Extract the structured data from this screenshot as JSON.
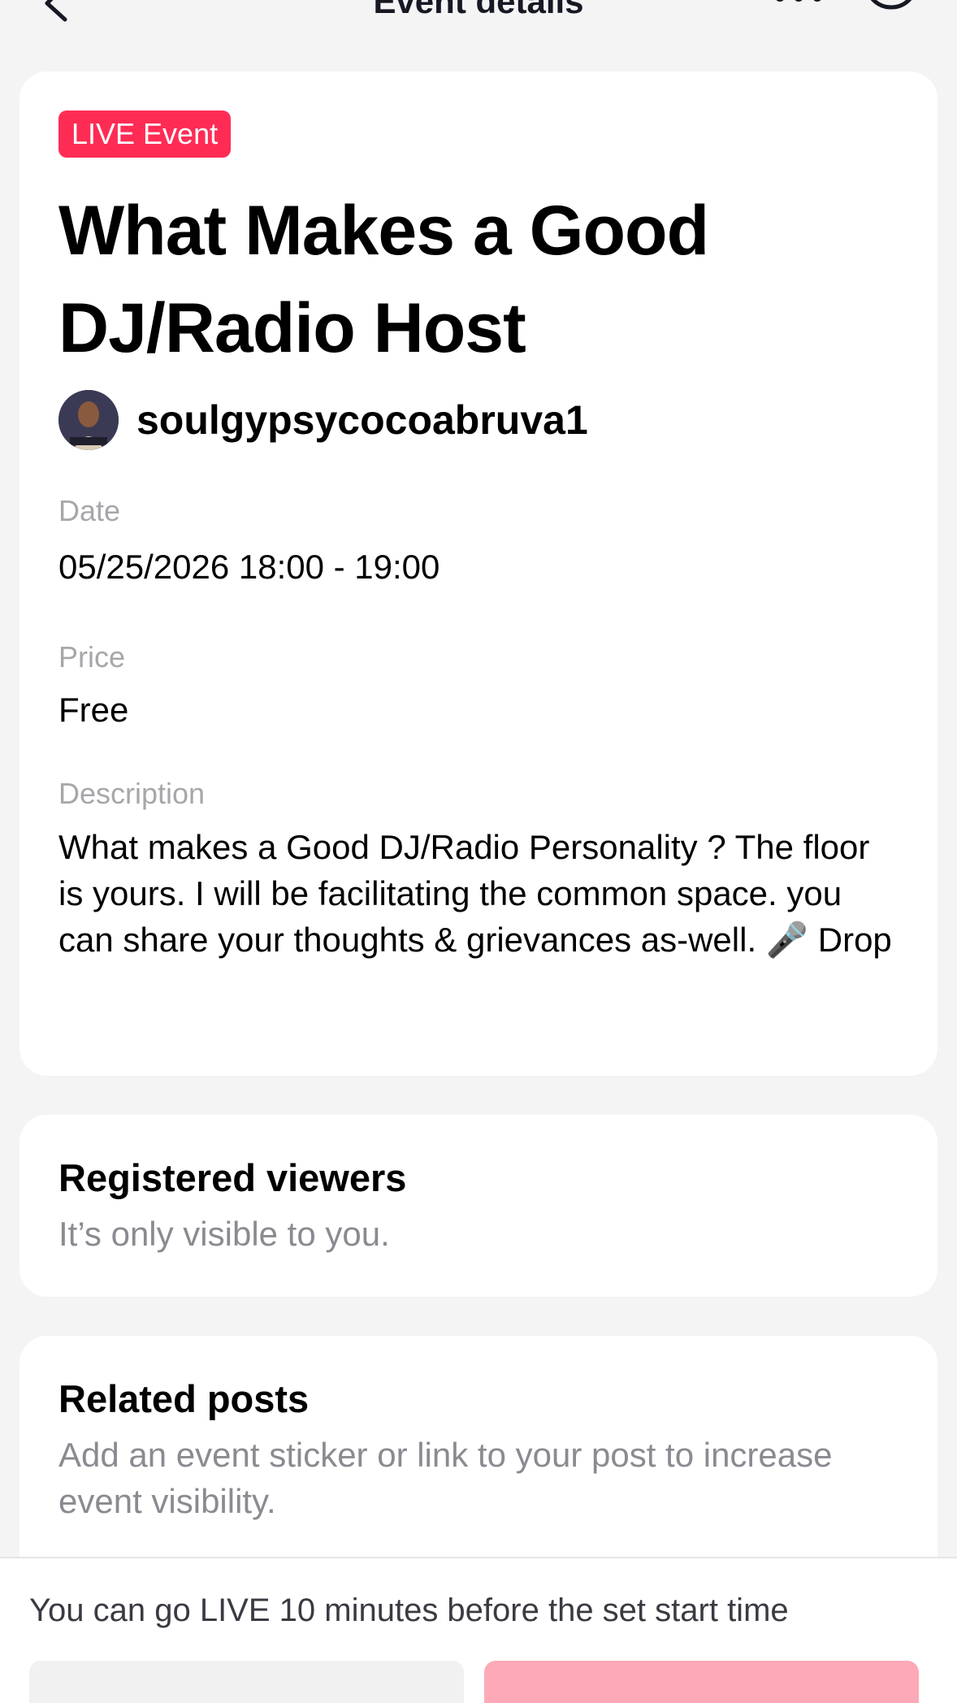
{
  "nav": {
    "title": "Event details"
  },
  "event": {
    "badge": "LIVE Event",
    "title": "What Makes a Good DJ/Radio Host",
    "host_name": "soulgypsycocoabruva1",
    "date_label": "Date",
    "date_value": "05/25/2026 18:00 - 19:00",
    "price_label": "Price",
    "price_value": "Free",
    "description_label": "Description",
    "description_value": "What makes a Good DJ/Radio Personality ? The floor is yours. I will be facilitating the common space. you can share your thoughts & grievances as-well. 🎤 Drop"
  },
  "registered": {
    "title": "Registered viewers",
    "subtitle": "It’s only visible to you."
  },
  "related": {
    "title": "Related posts",
    "subtitle": "Add an event sticker or link to your post to increase event visibility."
  },
  "footer": {
    "note": "You can go LIVE 10 minutes before the set start time"
  },
  "colors": {
    "accent": "#fe2c55",
    "background": "#f4f4f5",
    "card": "#ffffff"
  },
  "icons": [
    "back-arrow-icon",
    "more-dots-icon",
    "help-circle-icon"
  ]
}
